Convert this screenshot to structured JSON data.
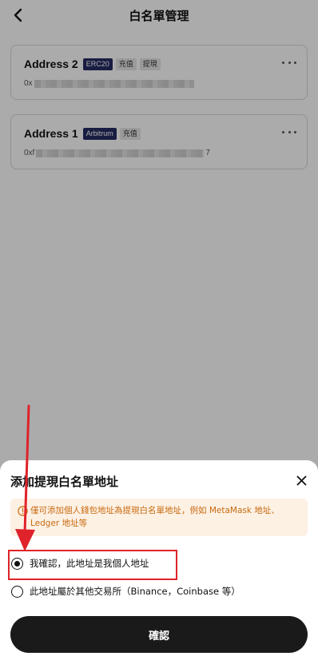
{
  "header": {
    "title": "白名單管理",
    "back_icon": "chevron-left-icon"
  },
  "addresses": [
    {
      "name": "Address 2",
      "network": "ERC20",
      "tags": [
        "充值",
        "提現"
      ],
      "address_prefix": "0x",
      "address_suffix": ""
    },
    {
      "name": "Address 1",
      "network": "Arbitrum",
      "tags": [
        "充值"
      ],
      "address_prefix": "0xf",
      "address_suffix": "7"
    }
  ],
  "sheet": {
    "title": "添加提現白名單地址",
    "close_icon": "close-icon",
    "warning": "僅可添加個人錢包地址為提現白名單地址，例如 MetaMask 地址、Ledger 地址等",
    "options": [
      {
        "label": "我確認，此地址是我個人地址",
        "selected": true
      },
      {
        "label": "此地址屬於其他交易所（Binance，Coinbase 等）",
        "selected": false
      }
    ],
    "confirm_label": "確認"
  },
  "colors": {
    "network_badge": "#262c63",
    "warning_bg": "#fdf1e4",
    "warning_text": "#c86a10",
    "annotation": "#e0222a",
    "button_bg": "#1a1a1a"
  }
}
